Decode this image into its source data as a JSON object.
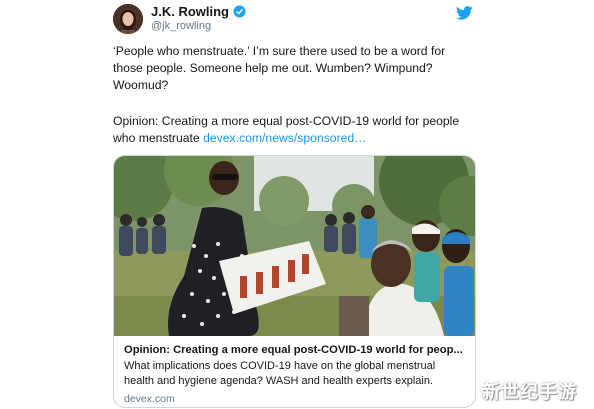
{
  "tweet": {
    "display_name": "J.K. Rowling",
    "handle": "@jk_rowling",
    "text_1": "‘People who menstruate.’ I’m sure there used to be a word for\nthose people. Someone help me out. Wumben? Wimpund?\nWoomud?",
    "text_2_prefix": "Opinion: Creating a more equal post-COVID-19 world for people\nwho menstruate ",
    "text_2_link": "devex.com/news/sponsored…",
    "icons": {
      "verified": "verified-badge-icon",
      "brand": "twitter-bird-icon"
    }
  },
  "card": {
    "title": "Opinion: Creating a more equal post-COVID-19 world for peop...",
    "description": "What implications does COVID-19 have on the global menstrual\nhealth and hygiene agenda? WASH and health experts explain.",
    "domain": "devex.com"
  },
  "watermark": "新世纪手游",
  "colors": {
    "link": "#1b95e0",
    "verified": "#1da1f2",
    "secondary_text": "#657786",
    "border": "#ccd6dd"
  }
}
